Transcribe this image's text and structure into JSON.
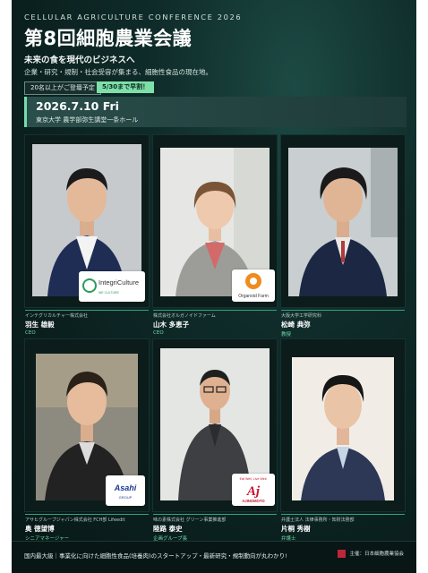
{
  "header": {
    "kicker": "CELLULAR AGRICULTURE CONFERENCE 2026",
    "title": "第8回細胞農業会議",
    "subtitle": "未来の食を現代のビジネスへ",
    "description": "企業・研究・規制・社会受容が集まる、細胞性食品の現在地。",
    "badge_attendance": "20名以上がご登壇予定",
    "badge_earlybird": "5/30まで早割！"
  },
  "event": {
    "date": "2026.7.10 Fri",
    "venue": "東京大学 農学部弥生講堂一条ホール"
  },
  "speakers": [
    {
      "company": "インテグリカルチャー株式会社",
      "name": "羽生 雄毅",
      "role": "CEO",
      "logo": {
        "line1": "IntegriCulture",
        "line2": "WE CULTURE",
        "line3": ""
      }
    },
    {
      "company": "株式会社オルガノイドファーム",
      "name": "山木 多恵子",
      "role": "CEO",
      "logo": {
        "line1": "Organoid Farm",
        "line2": "",
        "line3": ""
      }
    },
    {
      "company": "大阪大学工学研究科",
      "name": "松崎 典弥",
      "role": "教授",
      "logo": null
    },
    {
      "company": "アサヒグループジャパン株式会社 FCH部 Lifeedit",
      "name": "奥 徳望博",
      "role": "シニアマネージャー",
      "logo": {
        "line1": "Asahi",
        "line2": "GROUP",
        "line3": ""
      }
    },
    {
      "company": "味の素株式会社 グリーン事業推進部",
      "name": "陸路 泰史",
      "role": "企画グループ長",
      "logo": {
        "line1": "Eat Well, Live Well.",
        "line2": "AJINOMOTO",
        "line3": ""
      }
    },
    {
      "company": "弁護士法人 法律事務所・知財法務部",
      "name": "片桐 秀樹",
      "role": "弁護士",
      "logo": null
    }
  ],
  "footer": {
    "text": "国内最大級｜事業化に向けた細胞性食品(培養肉)のスタートアップ・最新研究・規制動向が丸わかり!",
    "organizer": "主催：日本細胞農業協会"
  }
}
